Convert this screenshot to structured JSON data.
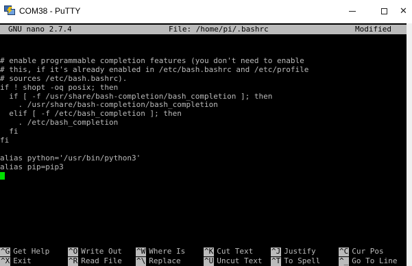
{
  "window": {
    "title": "COM38 - PuTTY",
    "icon": "putty-icon",
    "minimize_label": "—",
    "close_label": "✕"
  },
  "nano": {
    "version": "GNU nano 2.7.4",
    "file": "File: /home/pi/.bashrc",
    "status": "Modified"
  },
  "editor": {
    "lines": [
      "# enable programmable completion features (you don't need to enable",
      "# this, if it's already enabled in /etc/bash.bashrc and /etc/profile",
      "# sources /etc/bash.bashrc).",
      "if ! shopt -oq posix; then",
      "  if [ -f /usr/share/bash-completion/bash_completion ]; then",
      "    . /usr/share/bash-completion/bash_completion",
      "  elif [ -f /etc/bash_completion ]; then",
      "    . /etc/bash_completion",
      "  fi",
      "fi",
      "",
      "alias python='/usr/bin/python3'",
      "alias pip=pip3"
    ]
  },
  "shortcuts": {
    "row1": [
      {
        "key": "^G",
        "label": "Get Help"
      },
      {
        "key": "^O",
        "label": "Write Out"
      },
      {
        "key": "^W",
        "label": "Where Is"
      },
      {
        "key": "^K",
        "label": "Cut Text"
      },
      {
        "key": "^J",
        "label": "Justify"
      },
      {
        "key": "^C",
        "label": "Cur Pos"
      }
    ],
    "row2": [
      {
        "key": "^X",
        "label": "Exit"
      },
      {
        "key": "^R",
        "label": "Read File"
      },
      {
        "key": "^\\",
        "label": "Replace"
      },
      {
        "key": "^U",
        "label": "Uncut Text"
      },
      {
        "key": "^T",
        "label": "To Spell"
      },
      {
        "key": "^_",
        "label": "Go To Line"
      }
    ]
  },
  "colors": {
    "terminal_bg": "#000000",
    "terminal_fg": "#bbbbbb",
    "cursor": "#00e000"
  }
}
